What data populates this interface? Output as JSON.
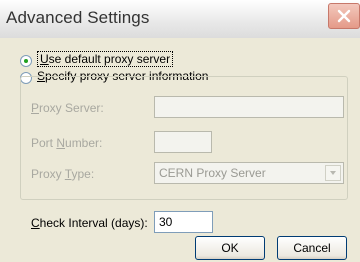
{
  "window": {
    "title": "Advanced Settings"
  },
  "proxy": {
    "use_default": {
      "prefix": "",
      "accel": "U",
      "rest": "se default proxy server",
      "checked": true
    },
    "specify": {
      "prefix": "",
      "accel": "S",
      "rest": "pecify proxy server information",
      "checked": false
    }
  },
  "fields": {
    "proxy_server": {
      "accel": "P",
      "rest": "roxy Server:",
      "value": ""
    },
    "port_number": {
      "prefix": "Port ",
      "accel": "N",
      "rest": "umber:",
      "value": ""
    },
    "proxy_type": {
      "prefix": "Proxy ",
      "accel": "T",
      "rest": "ype:",
      "value": "CERN Proxy Server"
    }
  },
  "check_interval": {
    "accel": "C",
    "rest": "heck Interval (days):",
    "value": "30"
  },
  "buttons": {
    "ok": "OK",
    "cancel": "Cancel"
  }
}
